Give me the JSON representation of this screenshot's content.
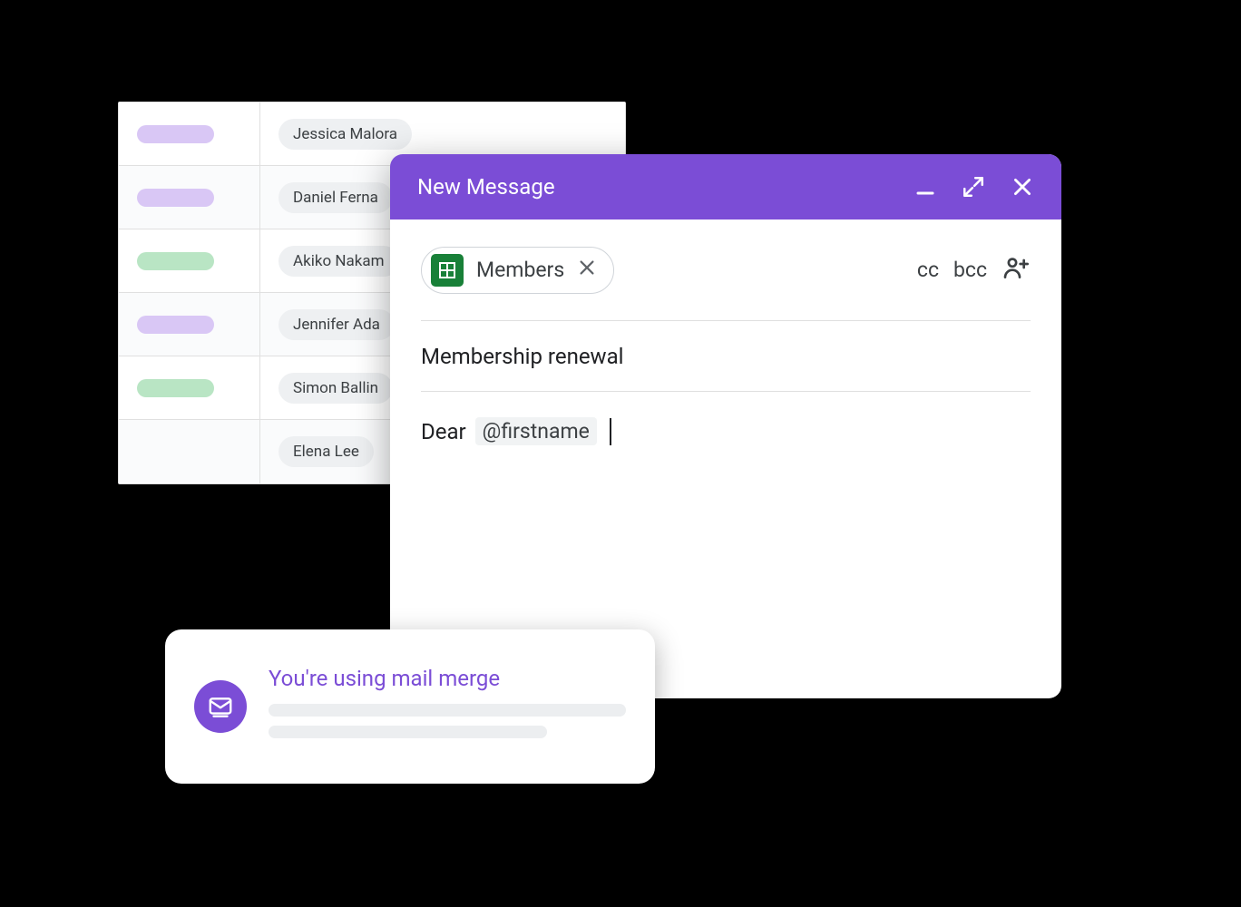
{
  "sheet": {
    "rows": [
      {
        "pill": "purple",
        "name": "Jessica Malora"
      },
      {
        "pill": "purple",
        "name": "Daniel Ferna"
      },
      {
        "pill": "green",
        "name": "Akiko Nakam"
      },
      {
        "pill": "purple",
        "name": "Jennifer Ada"
      },
      {
        "pill": "green",
        "name": "Simon Ballin"
      },
      {
        "pill": "",
        "name": "Elena Lee"
      }
    ]
  },
  "compose": {
    "title": "New Message",
    "to_chip_label": "Members",
    "cc_label": "cc",
    "bcc_label": "bcc",
    "subject": "Membership renewal",
    "body_prefix": "Dear",
    "merge_token": "@firstname"
  },
  "notice": {
    "title": "You're using mail merge"
  },
  "colors": {
    "accent": "#7b4dd6",
    "sheets_green": "#188038",
    "pill_purple": "#d9c7f5",
    "pill_green": "#b9e5c4"
  }
}
